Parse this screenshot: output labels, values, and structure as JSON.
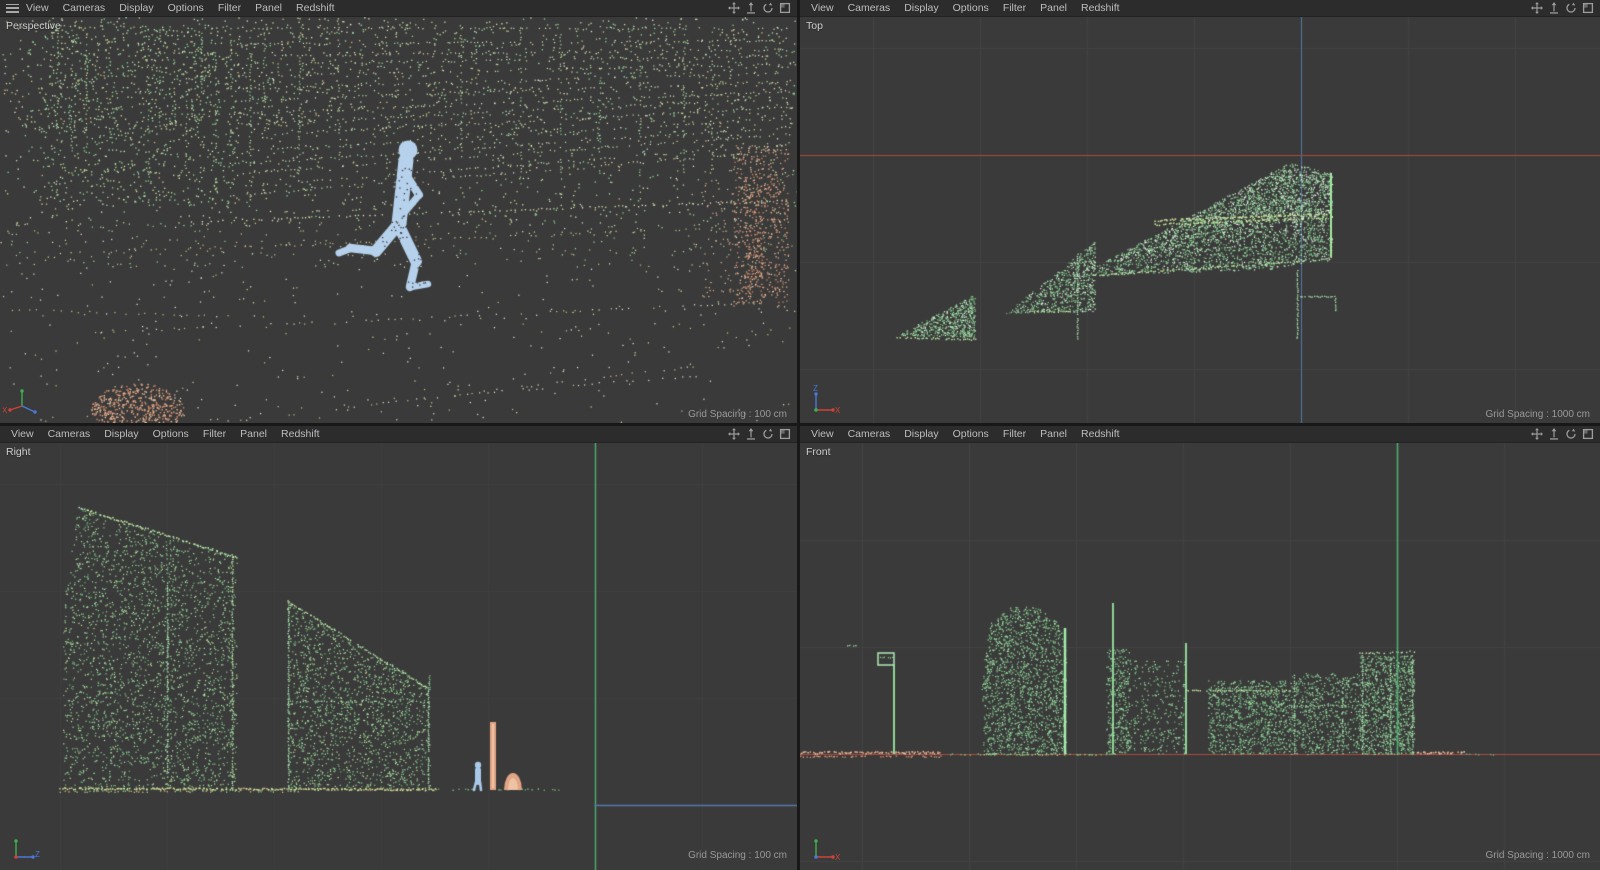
{
  "viewports": [
    {
      "label": "Perspective",
      "grid_spacing": "Grid Spacing : 100 cm",
      "menu": [
        "View",
        "Cameras",
        "Display",
        "Options",
        "Filter",
        "Panel",
        "Redshift"
      ]
    },
    {
      "label": "Top",
      "grid_spacing": "Grid Spacing : 1000 cm",
      "menu": [
        "View",
        "Cameras",
        "Display",
        "Options",
        "Filter",
        "Panel",
        "Redshift"
      ]
    },
    {
      "label": "Right",
      "grid_spacing": "Grid Spacing : 100 cm",
      "menu": [
        "View",
        "Cameras",
        "Display",
        "Options",
        "Filter",
        "Panel",
        "Redshift"
      ]
    },
    {
      "label": "Front",
      "grid_spacing": "Grid Spacing : 1000 cm",
      "menu": [
        "View",
        "Cameras",
        "Display",
        "Options",
        "Filter",
        "Panel",
        "Redshift"
      ]
    }
  ],
  "axis_labels": {
    "x": "X",
    "y": "Y",
    "z": "Z"
  },
  "viewport_icons": [
    "pan-icon",
    "dolly-icon",
    "rotate-icon",
    "maximize-view-icon"
  ],
  "colors": {
    "viewport_bg": "#3a3a3a",
    "grid_line": "#424242",
    "grid_line_faint": "#3f3f3f",
    "menubar_bg": "#2c2c2c",
    "menu_text": "#bdbdbd",
    "icon_gray": "#9c9c9c",
    "axis_red": "#a94a40",
    "axis_blue": "#5578a8",
    "axis_green": "#4fae70",
    "gizmo_red": "#cc4438",
    "gizmo_green": "#3fb04f",
    "gizmo_blue": "#4a78d8",
    "pc_green": "#8fd897",
    "pc_green_lt": "#aee8b4",
    "pc_green_pale": "#cdf0a0",
    "pc_green_dk": "#6fb87b",
    "pc_white": "#eef6ee",
    "pc_yellow": "#d9e3a0",
    "pc_cream": "#e9ecd0",
    "pc_gold": "#d2c484",
    "pc_salmon": "#e2a585",
    "pc_salmon_lt": "#eec3a4",
    "pc_salmon_dk": "#cf8a68",
    "runner_blue": "#b6d1ec",
    "person_blue": "#a9c9e9"
  }
}
